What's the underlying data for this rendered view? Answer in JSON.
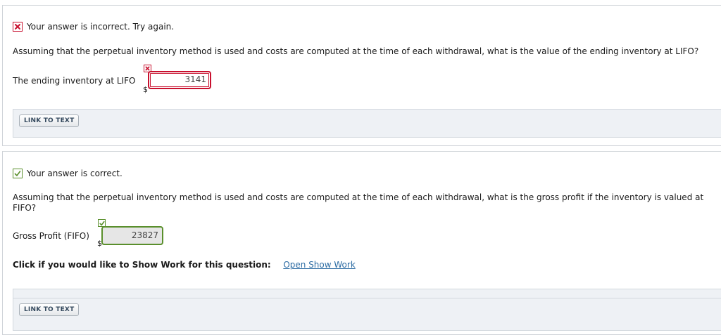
{
  "q1": {
    "status": "Your answer is incorrect.  Try again.",
    "question": "Assuming that the perpetual inventory method is used and costs are computed at the time of each withdrawal, what is the value of the ending inventory at LIFO?",
    "field_label": "The ending inventory at LIFO",
    "currency": "$",
    "answer_value": "3141",
    "link_to_text": "LINK TO TEXT"
  },
  "q2": {
    "status": "Your answer is correct.",
    "question_line1": "Assuming that the perpetual inventory method is used and costs are computed at the time of each withdrawal, what is the gross profit if the inventory is valued at",
    "question_line2": "FIFO?",
    "field_label": "Gross Profit (FIFO)",
    "currency": "$",
    "answer_value": "23827",
    "show_work_prompt": "Click if you would like to Show Work for this question:",
    "show_work_link": "Open Show Work",
    "link_to_text": "LINK TO TEXT"
  },
  "icons": {
    "incorrect": "x-mark-icon",
    "correct": "check-mark-icon"
  },
  "colors": {
    "incorrect": "#c8102e",
    "correct": "#5a8f2c",
    "link": "#2e6da4"
  }
}
